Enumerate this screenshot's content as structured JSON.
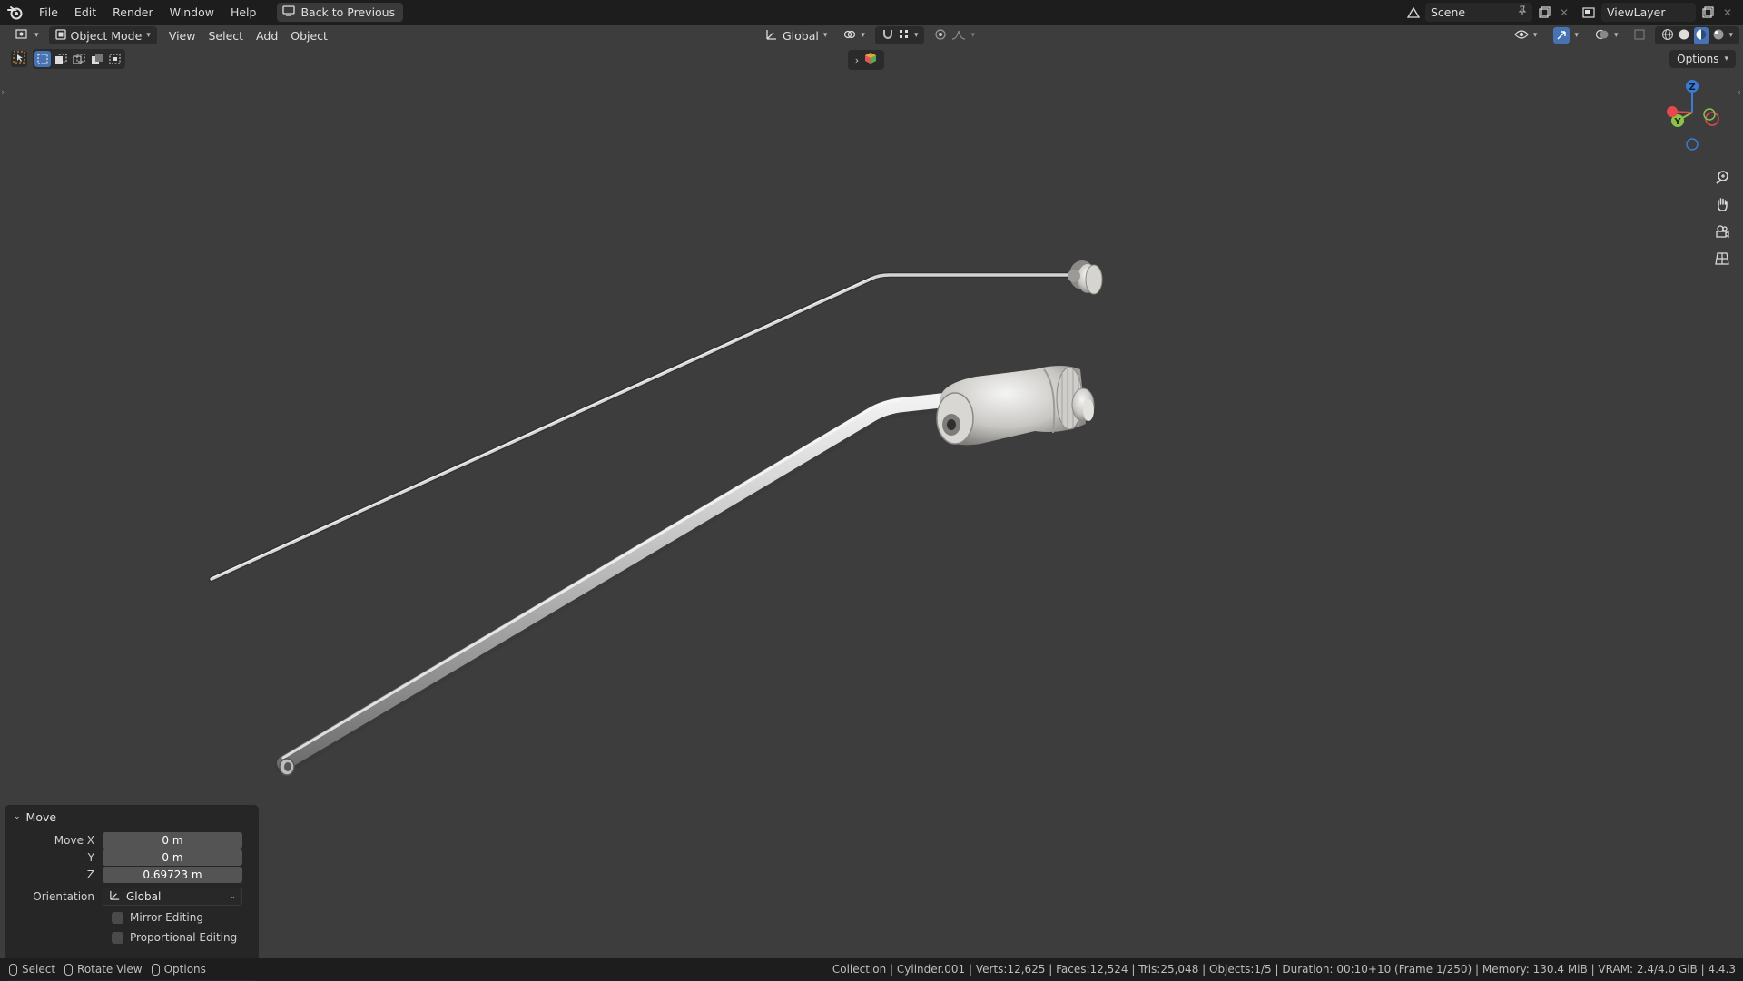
{
  "menu": {
    "file": "File",
    "edit": "Edit",
    "render": "Render",
    "window": "Window",
    "help": "Help",
    "back_button": "Back to Previous"
  },
  "topbar_right": {
    "scene": "Scene",
    "view_layer": "ViewLayer"
  },
  "viewport_header": {
    "mode": "Object Mode",
    "view": "View",
    "select": "Select",
    "add": "Add",
    "object": "Object",
    "orientation": "Global",
    "options": "Options"
  },
  "gizmo": {
    "z": "Z",
    "y": "Y"
  },
  "operator_panel": {
    "title": "Move",
    "move_x_label": "Move X",
    "move_x_value": "0 m",
    "y_label": "Y",
    "y_value": "0 m",
    "z_label": "Z",
    "z_value": "0.69723 m",
    "orientation_label": "Orientation",
    "orientation_value": "Global",
    "mirror_editing": "Mirror Editing",
    "proportional_editing": "Proportional Editing"
  },
  "statusbar": {
    "select": "Select",
    "rotate_view": "Rotate View",
    "options": "Options",
    "stats": "Collection | Cylinder.001 | Verts:12,625 | Faces:12,524 | Tris:25,048 | Objects:1/5 | Duration: 00:10+10 (Frame 1/250) | Memory: 130.4 MiB | VRAM: 2.4/4.0 GiB | 4.4.3"
  },
  "colors": {
    "viewport_bg": "#3d3d3d",
    "header_bg": "#1d1d1d",
    "accent": "#4772b3",
    "axis_x": "#e8484c",
    "axis_y": "#8bc34a",
    "axis_z": "#3a7bd5"
  }
}
